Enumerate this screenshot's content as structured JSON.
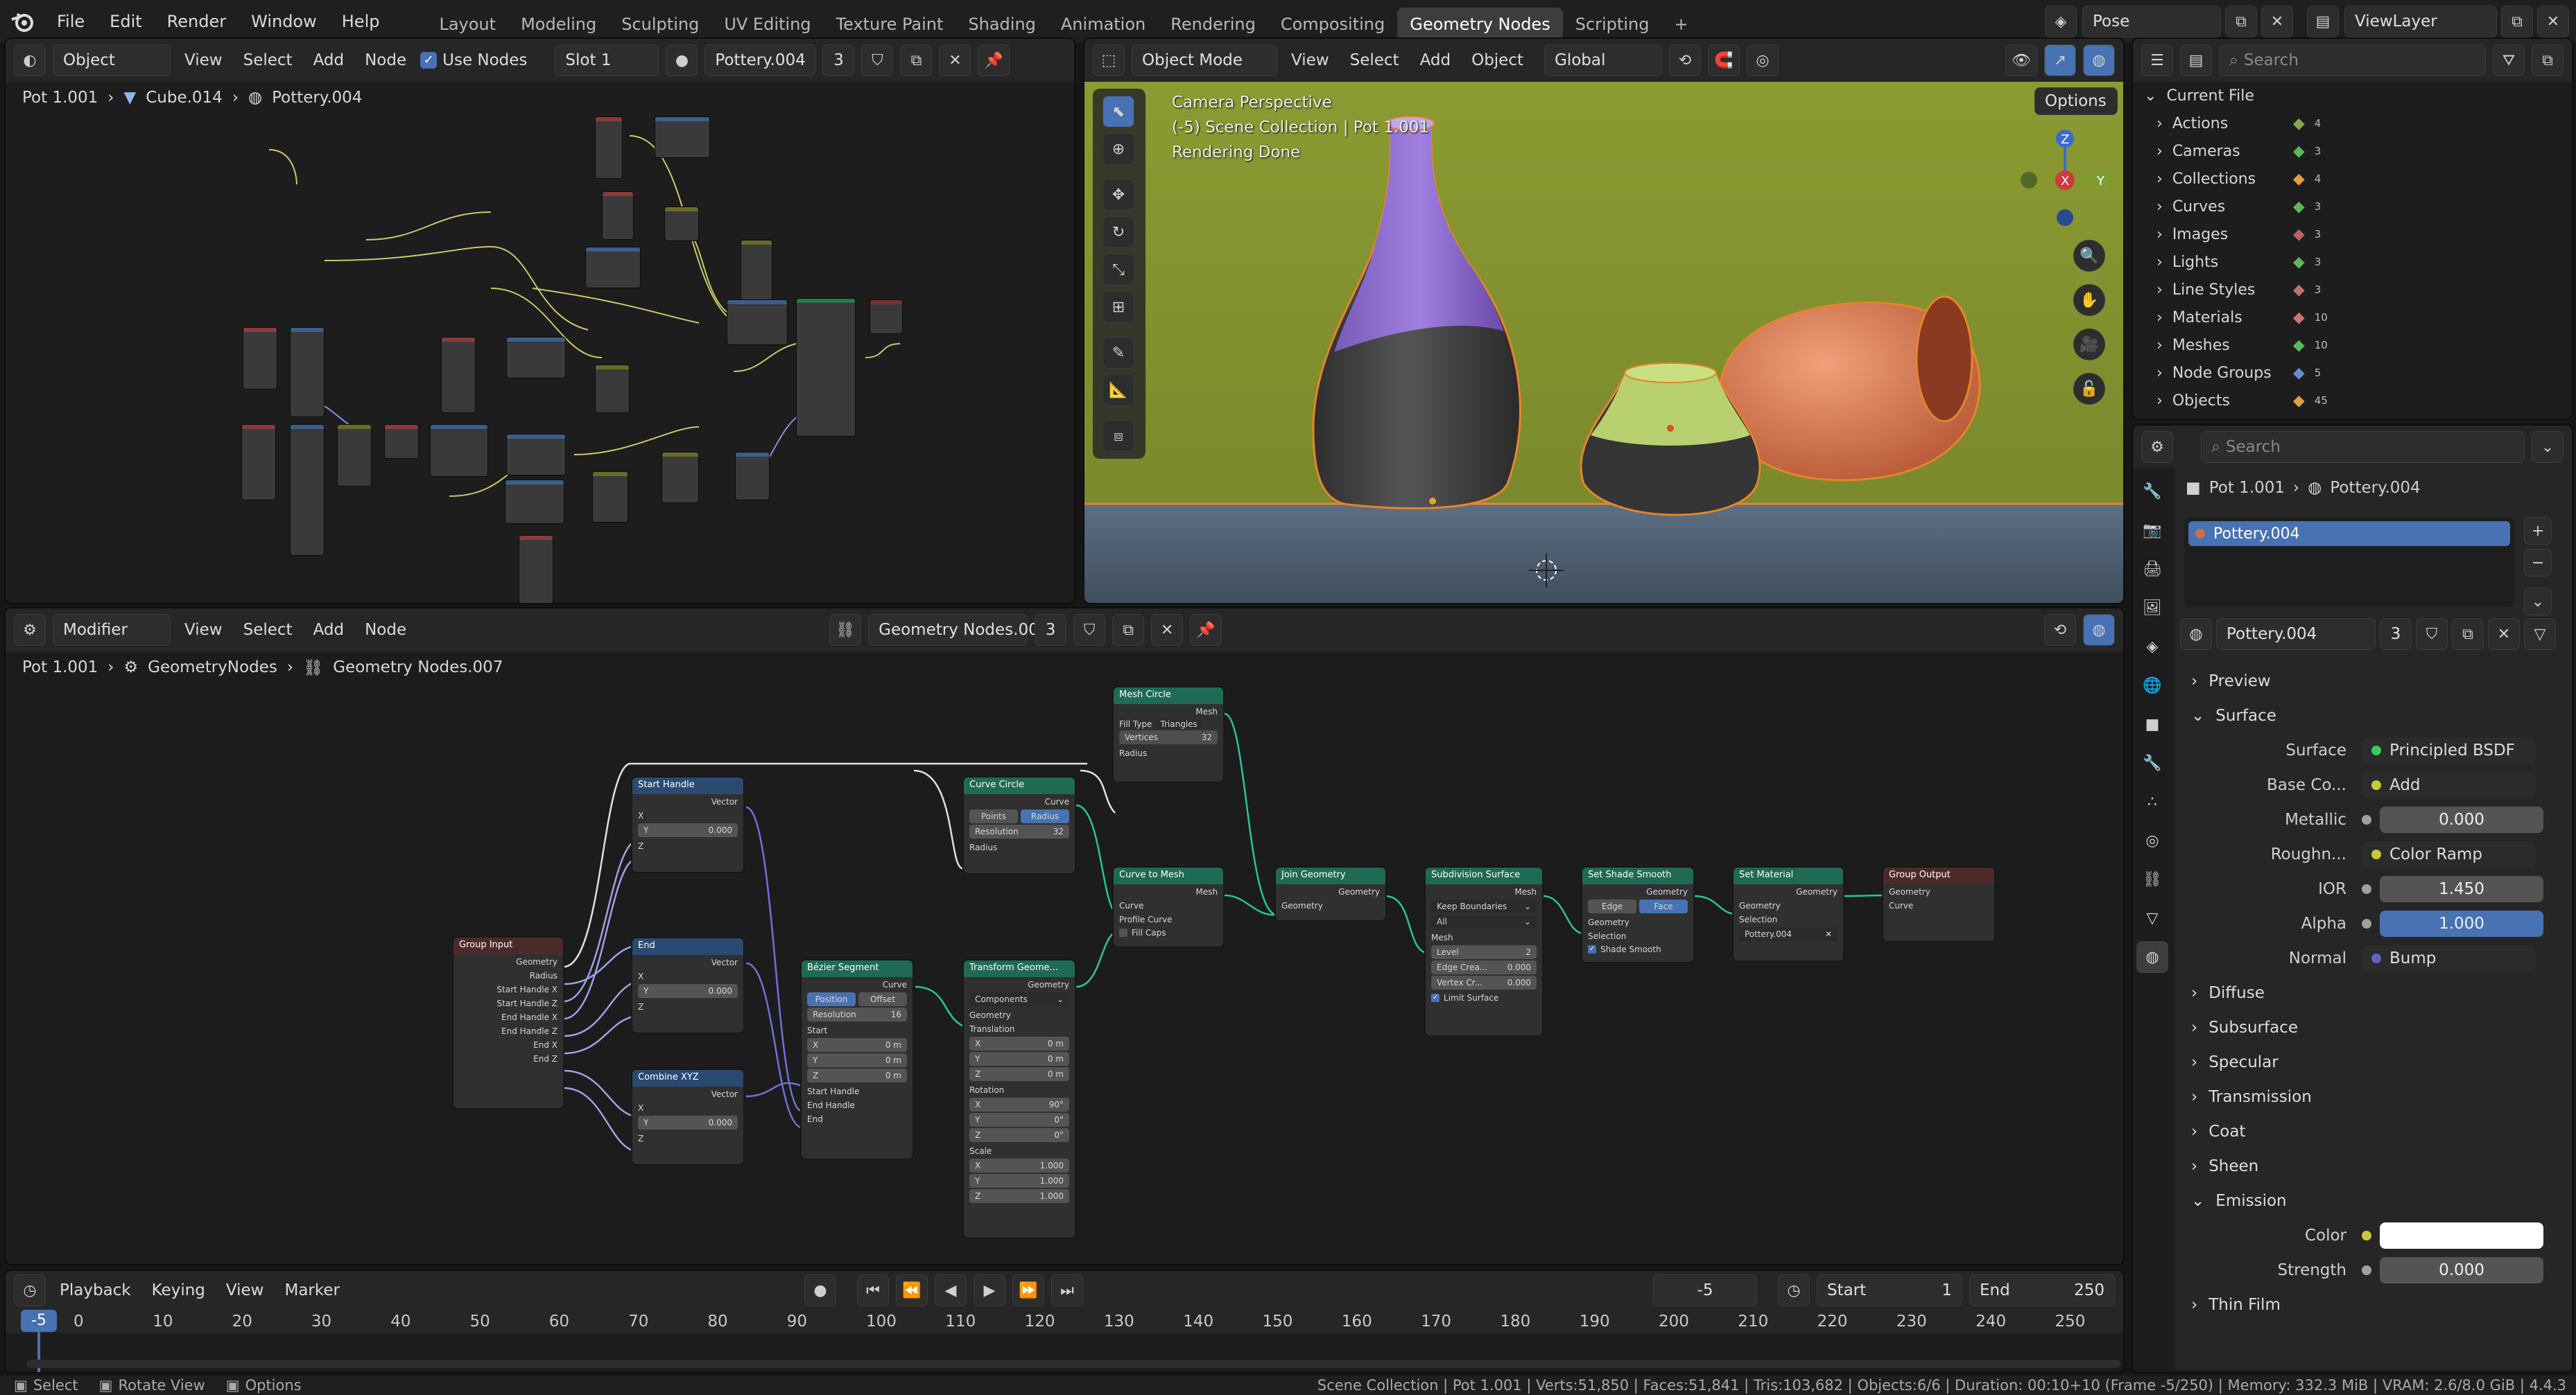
{
  "topbar": {
    "menus": [
      "File",
      "Edit",
      "Render",
      "Window",
      "Help"
    ],
    "workspaces": [
      "Layout",
      "Modeling",
      "Sculpting",
      "UV Editing",
      "Texture Paint",
      "Shading",
      "Animation",
      "Rendering",
      "Compositing",
      "Geometry Nodes",
      "Scripting"
    ],
    "active_workspace": "Geometry Nodes",
    "add_tab": "+",
    "scene": "Pose",
    "view_layer": "ViewLayer"
  },
  "shader_editor": {
    "mode": "Object",
    "menus": [
      "View",
      "Select",
      "Add",
      "Node"
    ],
    "use_nodes": "Use Nodes",
    "slot": "Slot 1",
    "material": "Pottery.004",
    "users": "3",
    "breadcrumb": [
      "Pot 1.001",
      "Cube.014",
      "Pottery.004"
    ]
  },
  "viewport": {
    "mode": "Object Mode",
    "menus": [
      "View",
      "Select",
      "Add",
      "Object"
    ],
    "orientation": "Global",
    "options": "Options",
    "info_line1": "Camera Perspective",
    "info_line2": "(-5) Scene Collection | Pot 1.001",
    "info_line3": "Rendering Done",
    "gizmo": {
      "z": "Z",
      "x": "X",
      "y": "Y"
    }
  },
  "geo_editor": {
    "mode": "Modifier",
    "menus": [
      "View",
      "Select",
      "Add",
      "Node"
    ],
    "node_group": "Geometry Nodes.007",
    "users": "3",
    "breadcrumb": [
      "Pot 1.001",
      "GeometryNodes",
      "Geometry Nodes.007"
    ],
    "nodes": {
      "group_input": {
        "title": "Group Input",
        "outputs": [
          "Geometry",
          "Radius",
          "Start Handle X",
          "Start Handle Z",
          "End Handle X",
          "End Handle Z",
          "End X",
          "End Z"
        ]
      },
      "start_handle": {
        "title": "Start Handle",
        "out": "Vector",
        "x": "X",
        "y": "Y",
        "yval": "0.000",
        "z": "Z"
      },
      "end": {
        "title": "End",
        "out": "Vector",
        "x": "X",
        "y": "Y",
        "yval": "0.000",
        "z": "Z"
      },
      "combine": {
        "title": "Combine XYZ",
        "out": "Vector",
        "x": "X",
        "y": "Y",
        "yval": "0.000",
        "z": "Z"
      },
      "bezier": {
        "title": "Bézier Segment",
        "out": "Curve",
        "mode_a": "Position",
        "mode_b": "Offset",
        "res_label": "Resolution",
        "res": "16",
        "start": "Start",
        "sx": "X",
        "sxv": "0 m",
        "sy": "Y",
        "syv": "0 m",
        "sz": "Z",
        "szv": "0 m",
        "start_handle": "Start Handle",
        "end_handle": "End Handle",
        "end": "End"
      },
      "curve_circle": {
        "title": "Curve Circle",
        "out": "Curve",
        "mode_a": "Points",
        "mode_b": "Radius",
        "res_label": "Resolution",
        "res": "32",
        "radius": "Radius"
      },
      "mesh_circle": {
        "title": "Mesh Circle",
        "out": "Mesh",
        "fill_label": "Fill Type",
        "fill": "Triangles",
        "verts_label": "Vertices",
        "verts": "32",
        "radius": "Radius"
      },
      "transform": {
        "title": "Transform Geome...",
        "out": "Geometry",
        "mode": "Components",
        "geom": "Geometry",
        "translation": "Translation",
        "tx": "X",
        "txv": "0 m",
        "ty": "Y",
        "tyv": "0 m",
        "tz": "Z",
        "tzv": "0 m",
        "rotation": "Rotation",
        "rx": "X",
        "rxv": "90°",
        "ry": "Y",
        "ryv": "0°",
        "rz": "Z",
        "rzv": "0°",
        "scale": "Scale",
        "scx": "X",
        "scxv": "1.000",
        "scy": "Y",
        "scyv": "1.000",
        "scz": "Z",
        "sczv": "1.000"
      },
      "curve_to_mesh": {
        "title": "Curve to Mesh",
        "out": "Mesh",
        "curve": "Curve",
        "profile": "Profile Curve",
        "fill": "Fill Caps"
      },
      "join": {
        "title": "Join Geometry",
        "out": "Geometry",
        "in": "Geometry"
      },
      "subdiv": {
        "title": "Subdivision Surface",
        "out": "Mesh",
        "boundary": "Keep Boundaries",
        "uv": "All",
        "mesh": "Mesh",
        "level_label": "Level",
        "level": "2",
        "edge_label": "Edge Crea...",
        "edge": "0.000",
        "vertex_label": "Vertex Cr...",
        "vertex": "0.000",
        "limit": "Limit Surface"
      },
      "shade_smooth": {
        "title": "Set Shade Smooth",
        "out": "Geometry",
        "mode_a": "Edge",
        "mode_b": "Face",
        "geom": "Geometry",
        "sel": "Selection",
        "smooth": "Shade Smooth"
      },
      "set_material": {
        "title": "Set Material",
        "out": "Geometry",
        "geom": "Geometry",
        "sel": "Selection",
        "mat": "Pottery.004"
      },
      "group_output": {
        "title": "Group Output",
        "geom": "Geometry",
        "curve": "Curve"
      }
    }
  },
  "outliner": {
    "search_placeholder": "Search",
    "root": "Current File",
    "items": [
      {
        "label": "Actions",
        "count": "4"
      },
      {
        "label": "Cameras",
        "count": "3"
      },
      {
        "label": "Collections",
        "count": "4"
      },
      {
        "label": "Curves",
        "count": "3"
      },
      {
        "label": "Images",
        "count": "3"
      },
      {
        "label": "Lights",
        "count": "3"
      },
      {
        "label": "Line Styles",
        "count": "3"
      },
      {
        "label": "Materials",
        "count": "10"
      },
      {
        "label": "Meshes",
        "count": "10"
      },
      {
        "label": "Node Groups",
        "count": "5"
      },
      {
        "label": "Objects",
        "count": "45"
      }
    ]
  },
  "properties": {
    "search_placeholder": "Search",
    "breadcrumb": [
      "Pot 1.001",
      "Pottery.004"
    ],
    "slot_item": "Pottery.004",
    "material_name": "Pottery.004",
    "material_users": "3",
    "sections": {
      "preview": "Preview",
      "surface": "Surface",
      "diffuse": "Diffuse",
      "subsurface": "Subsurface",
      "specular": "Specular",
      "transmission": "Transmission",
      "coat": "Coat",
      "sheen": "Sheen",
      "emission": "Emission",
      "thin_film": "Thin Film"
    },
    "surface": {
      "label": "Surface",
      "value": "Principled BSDF"
    },
    "rows": [
      {
        "label": "Base Co...",
        "value": "Add",
        "type": "socket",
        "color": "#c8c83c"
      },
      {
        "label": "Metallic",
        "value": "0.000",
        "type": "num"
      },
      {
        "label": "Roughn...",
        "value": "Color Ramp",
        "type": "socket",
        "color": "#c8c83c"
      },
      {
        "label": "IOR",
        "value": "1.450",
        "type": "num"
      },
      {
        "label": "Alpha",
        "value": "1.000",
        "type": "blue"
      },
      {
        "label": "Normal",
        "value": "Bump",
        "type": "socket",
        "color": "#6363c7"
      }
    ],
    "emission": {
      "color_label": "Color",
      "strength_label": "Strength",
      "strength": "0.000",
      "color": "#ffffff"
    }
  },
  "timeline": {
    "menus": [
      "Playback",
      "Keying",
      "View",
      "Marker"
    ],
    "current": "-5",
    "start_label": "Start",
    "start": "1",
    "end_label": "End",
    "end": "250",
    "ticks": [
      "0",
      "10",
      "20",
      "30",
      "40",
      "50",
      "60",
      "70",
      "80",
      "90",
      "100",
      "110",
      "120",
      "130",
      "140",
      "150",
      "160",
      "170",
      "180",
      "190",
      "200",
      "210",
      "220",
      "230",
      "240",
      "250"
    ]
  },
  "status": {
    "left": [
      "Select",
      "Rotate View",
      "Options"
    ],
    "right": "Scene Collection | Pot 1.001 | Verts:51,850 | Faces:51,841 | Tris:103,682 | Objects:6/6 | Duration: 00:10+10 (Frame -5/250) | Memory: 332.3 MiB | VRAM: 2.6/8.0 GiB | 4.4.3"
  },
  "colors": {
    "accent": "#4772b3",
    "selection": "#e8832a",
    "node_geo": "#00876b",
    "node_input": "#7a2f2f",
    "node_vector": "#2a5a8a"
  }
}
